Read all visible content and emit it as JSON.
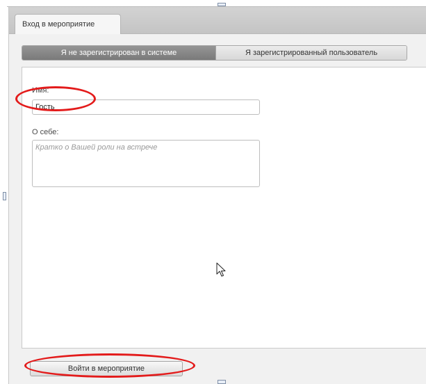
{
  "dialog": {
    "tab_label": "Вход в мероприятие"
  },
  "switcher": {
    "unregistered_label": "Я не зарегистрирован в системе",
    "registered_label": "Я зарегистрированный пользователь",
    "active": "unregistered"
  },
  "form": {
    "name_label": "Имя:",
    "name_value": "Гость",
    "about_label": "О себе:",
    "about_value": "",
    "about_placeholder": "Кратко о Вашей роли на встрече"
  },
  "footer": {
    "join_button_label": "Войти в мероприятие"
  },
  "colors": {
    "annotation": "#e31b1b",
    "active_segment": "#858585"
  },
  "icons": {
    "cursor": "arrow-cursor-icon"
  }
}
